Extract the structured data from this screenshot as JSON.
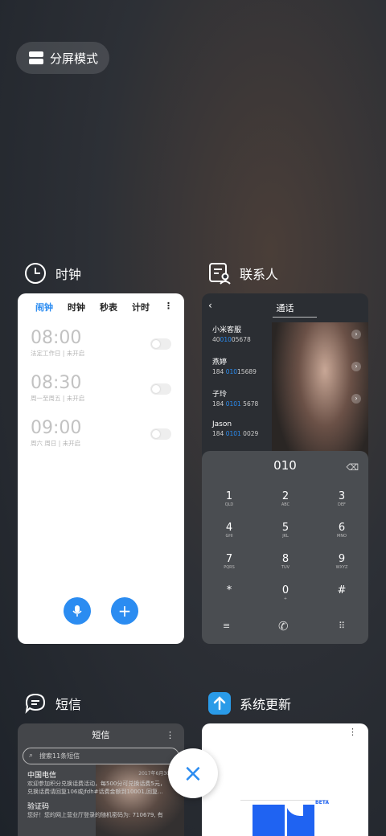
{
  "split_mode": {
    "label": "分屏模式",
    "icon": "split-screen-icon"
  },
  "cards": {
    "clock": {
      "app_name": "时钟",
      "icon": "clock-icon",
      "tabs": [
        "闹钟",
        "时钟",
        "秒表",
        "计时"
      ],
      "active_tab": "闹钟",
      "more_label": "⋮",
      "alarms": [
        {
          "time": "08:00",
          "desc": "法定工作日 | 未开启",
          "enabled": false
        },
        {
          "time": "08:30",
          "desc": "周一至周五 | 未开启",
          "enabled": false
        },
        {
          "time": "09:00",
          "desc": "周六 周日 | 未开启",
          "enabled": false
        }
      ],
      "mic_icon": "microphone-icon",
      "add_label": "+"
    },
    "contacts": {
      "app_name": "联系人",
      "icon": "contacts-icon",
      "title": "通话",
      "back_label": "‹",
      "contacts": [
        {
          "name": "小米客服",
          "num_pre": "40",
          "num_hl": "010",
          "num_post": "05678"
        },
        {
          "name": "燕婷",
          "num_pre": "184 ",
          "num_hl": "010",
          "num_post": "15689"
        },
        {
          "name": "子玲",
          "num_pre": "184 ",
          "num_hl": "0101",
          "num_post": " 5678"
        },
        {
          "name": "Jason",
          "num_pre": "184 ",
          "num_hl": "0101",
          "num_post": " 0029"
        }
      ],
      "arrow_label": "›",
      "dial_number": "010",
      "backspace_label": "⌫",
      "keys": [
        {
          "d": "1",
          "l": "QLD"
        },
        {
          "d": "2",
          "l": "ABC"
        },
        {
          "d": "3",
          "l": "DEF"
        },
        {
          "d": "4",
          "l": "GHI"
        },
        {
          "d": "5",
          "l": "JKL"
        },
        {
          "d": "6",
          "l": "MNO"
        },
        {
          "d": "7",
          "l": "PQRS"
        },
        {
          "d": "8",
          "l": "TUV"
        },
        {
          "d": "9",
          "l": "WXYZ"
        },
        {
          "d": "*",
          "l": ""
        },
        {
          "d": "0",
          "l": "+"
        },
        {
          "d": "#",
          "l": ""
        }
      ],
      "menu_label": "≡",
      "call_label": "✆",
      "keypad_label": "⠿"
    },
    "sms": {
      "app_name": "短信",
      "icon": "message-icon",
      "title": "短信",
      "more_label": "⋮",
      "search_placeholder": "搜索11条短信",
      "messages": [
        {
          "title": "中国电信",
          "date": "2017年6月30日",
          "body1": "欢迎参加积分兑换话费活动，每500分可兑换话费5元，",
          "body2": "兑换话费请回复106或jfdh#话费金额到10001,回复..."
        },
        {
          "title": "验证码",
          "date": "",
          "body1": "您好！您的网上营业厅登录的随机密码为: 710679, 有",
          "body2": ""
        }
      ]
    },
    "update": {
      "app_name": "系统更新",
      "icon": "system-update-icon",
      "more_label": "⋮",
      "beta_label": "BETA"
    }
  },
  "close_label": "×"
}
